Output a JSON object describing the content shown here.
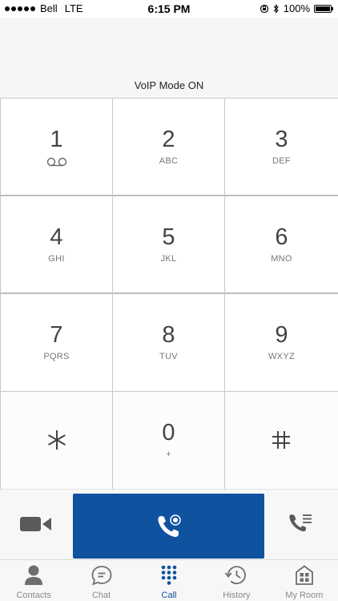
{
  "status_bar": {
    "carrier": "Bell",
    "network": "LTE",
    "time": "6:15 PM",
    "battery": "100%"
  },
  "voip_mode": "VoIP Mode ON",
  "keypad": {
    "keys": [
      {
        "digit": "1",
        "letters": ""
      },
      {
        "digit": "2",
        "letters": "ABC"
      },
      {
        "digit": "3",
        "letters": "DEF"
      },
      {
        "digit": "4",
        "letters": "GHI"
      },
      {
        "digit": "5",
        "letters": "JKL"
      },
      {
        "digit": "6",
        "letters": "MNO"
      },
      {
        "digit": "7",
        "letters": "PQRS"
      },
      {
        "digit": "8",
        "letters": "TUV"
      },
      {
        "digit": "9",
        "letters": "WXYZ"
      },
      {
        "digit": "*",
        "letters": ""
      },
      {
        "digit": "0",
        "letters": "+"
      },
      {
        "digit": "#",
        "letters": ""
      }
    ]
  },
  "tabs": [
    {
      "label": "Contacts",
      "icon": "person-icon"
    },
    {
      "label": "Chat",
      "icon": "chat-bubble-icon"
    },
    {
      "label": "Call",
      "icon": "dialpad-icon",
      "active": true
    },
    {
      "label": "History",
      "icon": "clock-history-icon"
    },
    {
      "label": "My Room",
      "icon": "room-grid-icon"
    }
  ],
  "colors": {
    "accent": "#0f52a0",
    "inactive": "#8a8a8a"
  }
}
